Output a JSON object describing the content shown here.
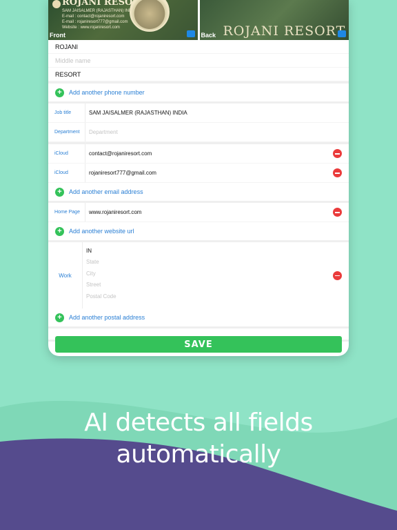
{
  "colors": {
    "background": "#8fe3c6",
    "wave_light": "#7fd8b7",
    "wave_purple": "#554b8d",
    "accent_green": "#34c25a",
    "link_blue": "#2a7fd4",
    "remove_red": "#ea3b3b"
  },
  "photos": {
    "front": {
      "badge": "Front",
      "title": "ROJANI RESORT",
      "lines": [
        "SAM JAISALMER (RAJASTHAN) INDIA",
        "E-mail : contact@rojaniresort.com",
        "E-mail : rojaniresort777@gmail.com",
        "Website : www.rojaniresort.com"
      ]
    },
    "back": {
      "badge": "Back",
      "title": "ROJANI RESORT"
    }
  },
  "name": {
    "first": "ROJANI",
    "middle_placeholder": "Middle name",
    "last": "RESORT"
  },
  "phone": {
    "add_label": "Add another phone number"
  },
  "job": {
    "job_title_label": "Job title",
    "job_title_value": "SAM JAISALMER (RAJASTHAN) INDIA",
    "department_label": "Department",
    "department_placeholder": "Department"
  },
  "emails": [
    {
      "label": "iCloud",
      "value": "contact@rojaniresort.com"
    },
    {
      "label": "iCloud",
      "value": "rojaniresort777@gmail.com"
    }
  ],
  "email_add_label": "Add another email address",
  "website": {
    "label": "Home Page",
    "value": "www.rojaniresort.com",
    "add_label": "Add another website url"
  },
  "address": {
    "label": "Work",
    "country": "IN",
    "state_placeholder": "State",
    "city_placeholder": "City",
    "street_placeholder": "Street",
    "postal_placeholder": "Postal Code",
    "add_label": "Add another postal address"
  },
  "save_label": "SAVE",
  "caption": {
    "line1": "AI detects all fields",
    "line2": "automatically"
  }
}
